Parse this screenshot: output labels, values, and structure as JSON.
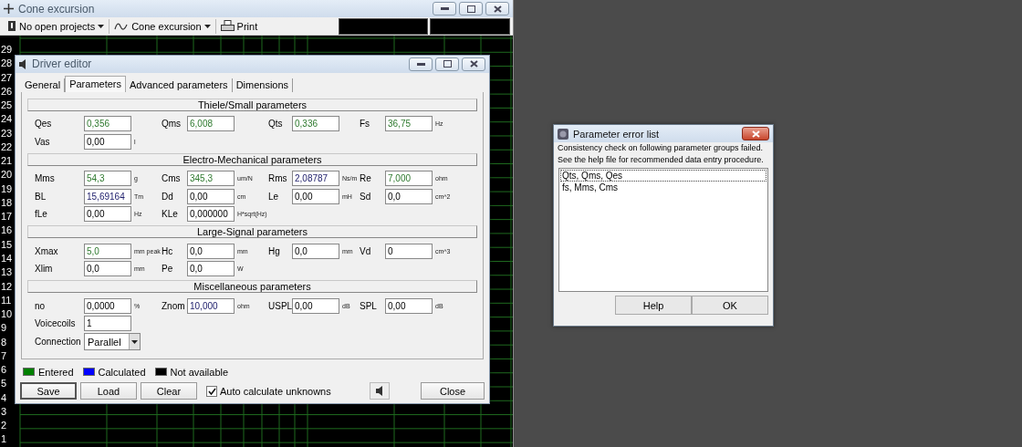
{
  "main_window": {
    "title": "Cone excursion",
    "toolbar": [
      {
        "kind": "dropdown",
        "label": "No open projects"
      },
      {
        "kind": "dropdown",
        "label": "Cone excursion"
      },
      {
        "kind": "button",
        "label": "Print"
      }
    ],
    "y_labels": [
      "29",
      "28",
      "27",
      "26",
      "25",
      "24",
      "23",
      "22",
      "21",
      "20",
      "19",
      "18",
      "17",
      "16",
      "15",
      "14",
      "13",
      "12",
      "11",
      "10",
      "9",
      "8",
      "7",
      "6",
      "5",
      "4",
      "3",
      "2",
      "1"
    ]
  },
  "driver_editor": {
    "title": "Driver editor",
    "tabs": [
      {
        "label": "General",
        "selected": false
      },
      {
        "label": "Parameters",
        "selected": true
      },
      {
        "label": "Advanced parameters",
        "selected": false
      },
      {
        "label": "Dimensions",
        "selected": false
      }
    ],
    "sections": [
      {
        "title": "Thiele/Small parameters",
        "rows": [
          [
            {
              "label": "Qes",
              "value": "0,356",
              "kind": "entered"
            },
            {
              "label": "Qms",
              "value": "6,008",
              "kind": "entered"
            },
            {
              "label": "Qts",
              "value": "0,336",
              "kind": "entered"
            },
            {
              "label": "Fs",
              "value": "36,75",
              "unit": "Hz",
              "kind": "entered"
            }
          ],
          [
            {
              "label": "Vas",
              "value": "0,00",
              "unit": "l",
              "kind": "plain"
            }
          ]
        ]
      },
      {
        "title": "Electro-Mechanical parameters",
        "rows": [
          [
            {
              "label": "Mms",
              "value": "54,3",
              "unit": "g",
              "kind": "entered"
            },
            {
              "label": "Cms",
              "value": "345,3",
              "unit": "um/N",
              "kind": "entered"
            },
            {
              "label": "Rms",
              "value": "2,08787",
              "unit": "Ns/m",
              "kind": "calculated"
            },
            {
              "label": "Re",
              "value": "7,000",
              "unit": "ohm",
              "kind": "entered"
            }
          ],
          [
            {
              "label": "BL",
              "value": "15,69164",
              "unit": "Tm",
              "kind": "calculated"
            },
            {
              "label": "Dd",
              "value": "0,00",
              "unit": "cm",
              "kind": "plain"
            },
            {
              "label": "Le",
              "value": "0,00",
              "unit": "mH",
              "kind": "plain"
            },
            {
              "label": "Sd",
              "value": "0,0",
              "unit": "cm^2",
              "kind": "plain"
            }
          ],
          [
            {
              "label": "fLe",
              "value": "0,00",
              "unit": "Hz",
              "kind": "plain"
            },
            {
              "label": "KLe",
              "value": "0,000000",
              "unit": "H*sqrt(Hz)",
              "kind": "plain"
            }
          ]
        ]
      },
      {
        "title": "Large-Signal parameters",
        "rows": [
          [
            {
              "label": "Xmax",
              "value": "5,0",
              "unit": "mm peak",
              "kind": "entered"
            },
            {
              "label": "Hc",
              "value": "0,0",
              "unit": "mm",
              "kind": "plain"
            },
            {
              "label": "Hg",
              "value": "0,0",
              "unit": "mm",
              "kind": "plain"
            },
            {
              "label": "Vd",
              "value": "0",
              "unit": "cm^3",
              "kind": "plain"
            }
          ],
          [
            {
              "label": "Xlim",
              "value": "0,0",
              "unit": "mm",
              "kind": "plain"
            },
            {
              "label": "Pe",
              "value": "0,0",
              "unit": "W",
              "kind": "plain"
            }
          ]
        ]
      },
      {
        "title": "Miscellaneous parameters",
        "rows": [
          [
            {
              "label": "no",
              "value": "0,0000",
              "unit": "%",
              "kind": "plain"
            },
            {
              "label": "Znom",
              "value": "10,000",
              "unit": "ohm",
              "kind": "calculated"
            },
            {
              "label": "USPL",
              "value": "0,00",
              "unit": "dB",
              "kind": "plain"
            },
            {
              "label": "SPL",
              "value": "0,00",
              "unit": "dB",
              "kind": "plain"
            }
          ],
          [
            {
              "label": "Voicecoils",
              "value": "1",
              "kind": "plain"
            }
          ],
          [
            {
              "label": "Connection",
              "value": "Parallel",
              "kind": "dropdown"
            }
          ]
        ]
      }
    ],
    "legend": [
      {
        "label": "Entered",
        "color": "#008000"
      },
      {
        "label": "Calculated",
        "color": "#0000ff"
      },
      {
        "label": "Not available",
        "color": "#000000"
      }
    ],
    "buttons": [
      {
        "label": "Save",
        "default": true
      },
      {
        "label": "Load",
        "default": false
      },
      {
        "label": "Clear",
        "default": false
      }
    ],
    "auto_calculate": {
      "label": "Auto calculate unknowns",
      "checked": true
    },
    "close_button": "Close"
  },
  "error_dialog": {
    "title": "Parameter error list",
    "message": [
      "Consistency check on following parameter groups failed.",
      "See the help file for recommended data entry procedure."
    ],
    "items": [
      {
        "label": "Qts, Qms, Qes",
        "selected": true
      },
      {
        "label": "fs, Mms, Cms",
        "selected": false
      }
    ],
    "buttons": [
      "Help",
      "OK"
    ]
  }
}
